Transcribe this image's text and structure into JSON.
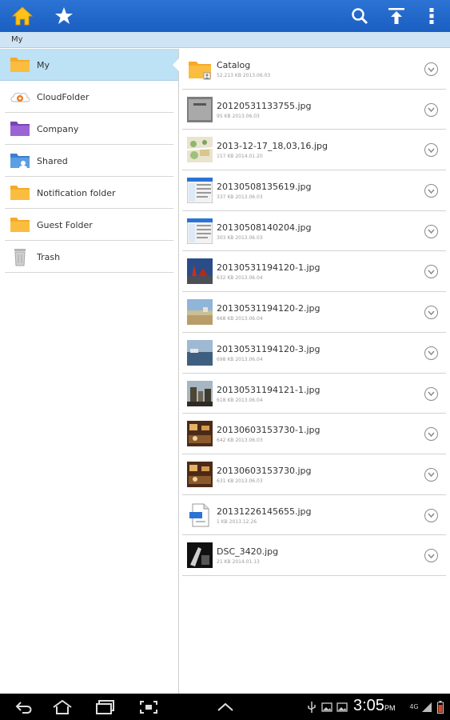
{
  "breadcrumb": "My",
  "colors": {
    "topbar": "#1f66c9",
    "path_bg": "#cfe4f5",
    "selected": "#bde1f5",
    "folder": "#f6a928",
    "folder_purple": "#8e55c8",
    "folder_blue": "#4a8fd6"
  },
  "toolbar": {
    "home_icon": "home-icon",
    "star_icon": "star-icon",
    "search_icon": "search-icon",
    "upload_icon": "upload-icon",
    "menu_icon": "overflow-menu-icon"
  },
  "sidebar": {
    "items": [
      {
        "label": "My",
        "icon": "folder-icon"
      },
      {
        "label": "CloudFolder",
        "icon": "cloud-folder-icon"
      },
      {
        "label": "Company",
        "icon": "company-folder-icon"
      },
      {
        "label": "Shared",
        "icon": "shared-folder-icon"
      },
      {
        "label": "Notification folder",
        "icon": "folder-icon"
      },
      {
        "label": "Guest Folder",
        "icon": "folder-icon"
      },
      {
        "label": "Trash",
        "icon": "trash-icon"
      }
    ]
  },
  "files": [
    {
      "name": "Catalog",
      "meta": "52.213 KB 2013.06.03",
      "kind": "folder"
    },
    {
      "name": "20120531133755.jpg",
      "meta": "95 KB 2013.06.03",
      "kind": "gray"
    },
    {
      "name": "2013-12-17_18,03,16.jpg",
      "meta": "157 KB 2014.01.20",
      "kind": "map"
    },
    {
      "name": "20130508135619.jpg",
      "meta": "337 KB 2013.06.03",
      "kind": "screen"
    },
    {
      "name": "20130508140204.jpg",
      "meta": "303 KB 2013.06.03",
      "kind": "screen"
    },
    {
      "name": "20130531194120-1.jpg",
      "meta": "632 KB 2013.06.04",
      "kind": "red"
    },
    {
      "name": "20130531194120-2.jpg",
      "meta": "668 KB 2013.06.04",
      "kind": "beach"
    },
    {
      "name": "20130531194120-3.jpg",
      "meta": "698 KB 2013.06.04",
      "kind": "sea"
    },
    {
      "name": "20130531194121-1.jpg",
      "meta": "618 KB 2013.06.04",
      "kind": "city"
    },
    {
      "name": "20130603153730-1.jpg",
      "meta": "642 KB 2013.06.03",
      "kind": "room"
    },
    {
      "name": "20130603153730.jpg",
      "meta": "631 KB 2013.06.03",
      "kind": "room"
    },
    {
      "name": "20131226145655.jpg",
      "meta": "1 KB 2013.12.26",
      "kind": "doc"
    },
    {
      "name": "DSC_3420.jpg",
      "meta": "21 KB 2014.01.13",
      "kind": "dark"
    }
  ],
  "status": {
    "time": "3:05",
    "ampm": "PM",
    "network": "4G"
  }
}
